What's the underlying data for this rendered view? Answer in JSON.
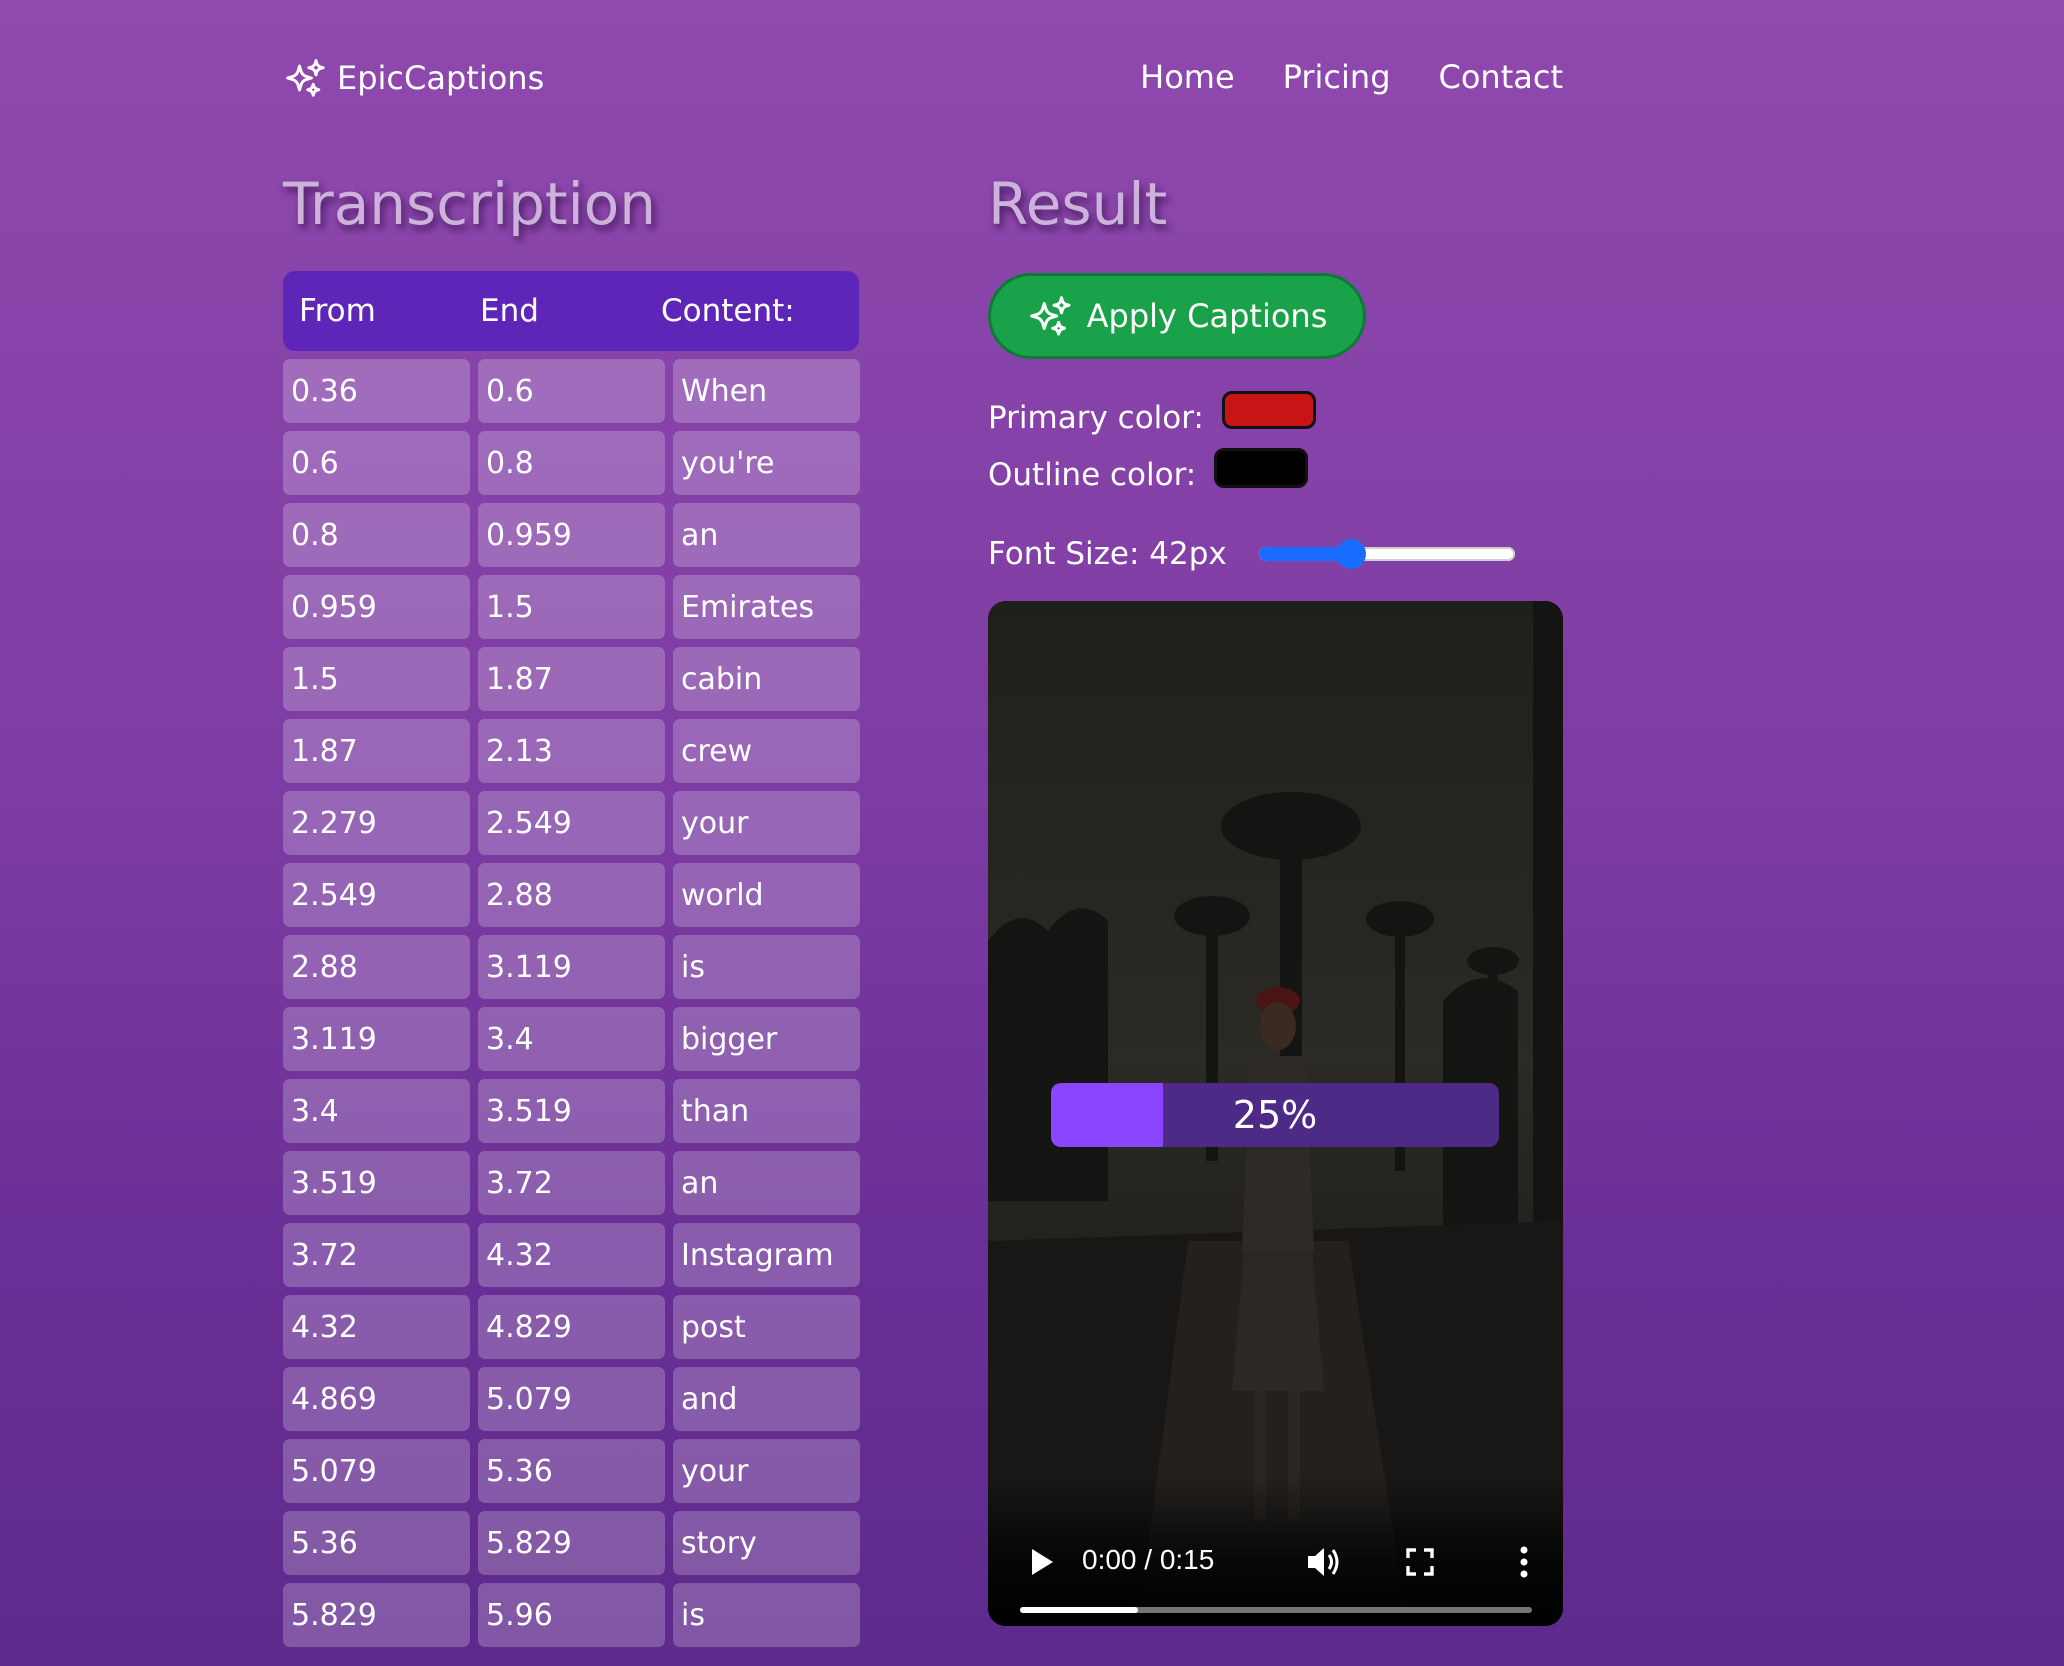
{
  "brand": {
    "name": "EpicCaptions",
    "icon": "sparkles-icon"
  },
  "nav": {
    "items": [
      "Home",
      "Pricing",
      "Contact"
    ]
  },
  "transcription": {
    "title": "Transcription",
    "headers": [
      "From",
      "End",
      "Content:"
    ],
    "rows": [
      [
        "0.36",
        "0.6",
        "When"
      ],
      [
        "0.6",
        "0.8",
        "you're"
      ],
      [
        "0.8",
        "0.959",
        "an"
      ],
      [
        "0.959",
        "1.5",
        "Emirates"
      ],
      [
        "1.5",
        "1.87",
        "cabin"
      ],
      [
        "1.87",
        "2.13",
        "crew"
      ],
      [
        "2.279",
        "2.549",
        "your"
      ],
      [
        "2.549",
        "2.88",
        "world"
      ],
      [
        "2.88",
        "3.119",
        "is"
      ],
      [
        "3.119",
        "3.4",
        "bigger"
      ],
      [
        "3.4",
        "3.519",
        "than"
      ],
      [
        "3.519",
        "3.72",
        "an"
      ],
      [
        "3.72",
        "4.32",
        "Instagram"
      ],
      [
        "4.32",
        "4.829",
        "post"
      ],
      [
        "4.869",
        "5.079",
        "and"
      ],
      [
        "5.079",
        "5.36",
        "your"
      ],
      [
        "5.36",
        "5.829",
        "story"
      ],
      [
        "5.829",
        "5.96",
        "is"
      ]
    ]
  },
  "result": {
    "title": "Result",
    "apply_label": "Apply Captions",
    "apply_icon": "sparkles-icon",
    "primary_color_label": "Primary color:",
    "primary_color": "#c81414",
    "outline_color_label": "Outline color:",
    "outline_color": "#000000",
    "font_size_label": "Font Size: 42px",
    "font_size_fraction": 0.36
  },
  "video": {
    "progress_percent": 25,
    "progress_label": "25%",
    "time": "0:00 / 0:15",
    "buffered_fraction": 0.23,
    "icons": [
      "play-icon",
      "volume-icon",
      "fullscreen-icon",
      "more-options-icon"
    ]
  }
}
